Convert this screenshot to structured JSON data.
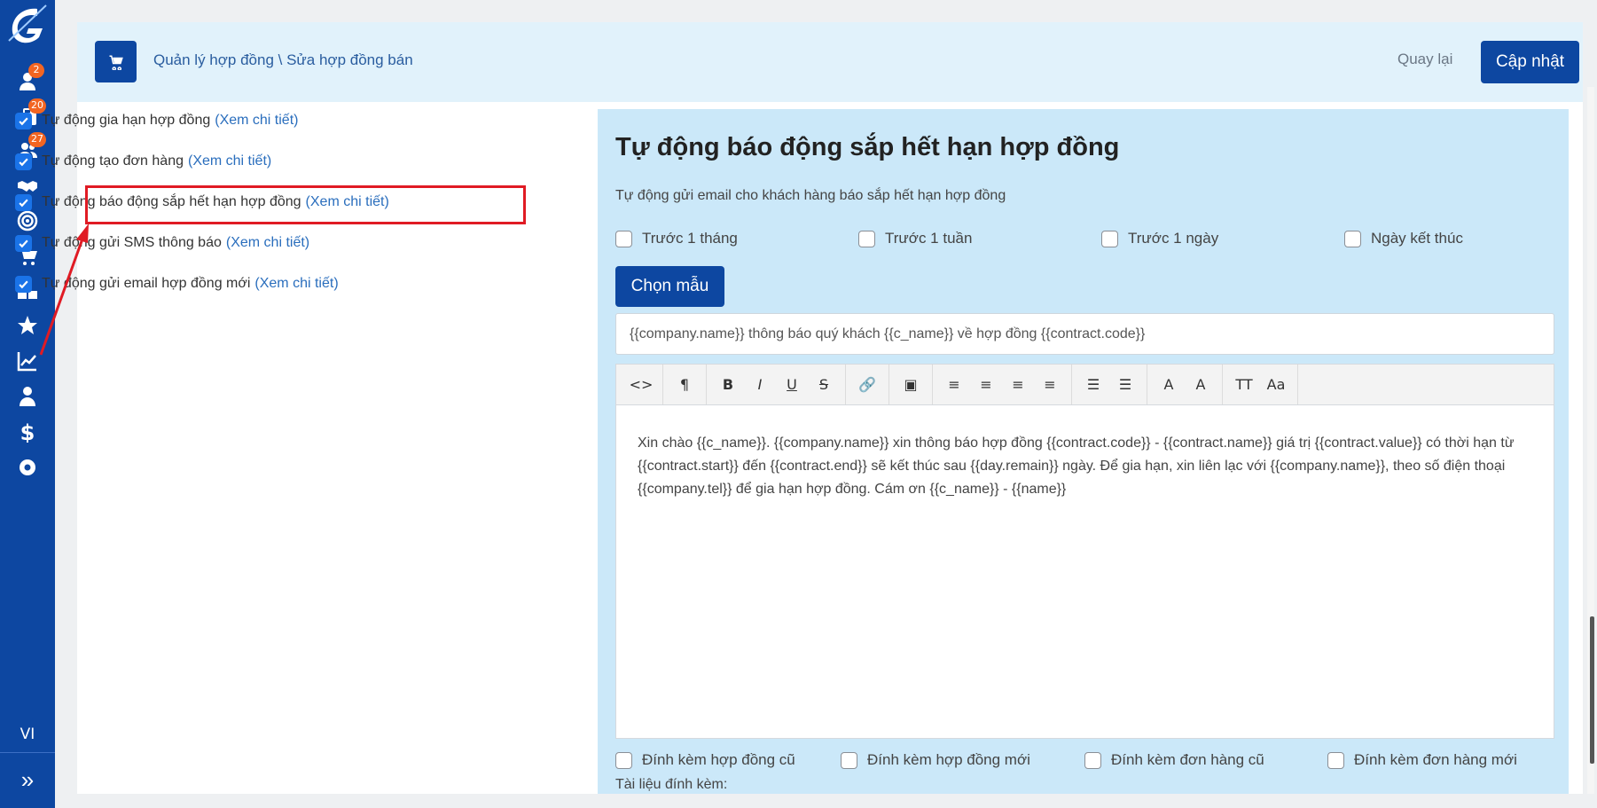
{
  "sidebar": {
    "items": [
      {
        "icon": "user-icon",
        "badge": "2"
      },
      {
        "icon": "briefcase-icon",
        "badge": "20"
      },
      {
        "icon": "users-icon",
        "badge": "27"
      },
      {
        "icon": "handshake-icon",
        "badge": ""
      },
      {
        "icon": "target-icon",
        "badge": ""
      },
      {
        "icon": "cart-icon",
        "badge": ""
      },
      {
        "icon": "cubes-icon",
        "badge": ""
      },
      {
        "icon": "star-icon",
        "badge": ""
      },
      {
        "icon": "chart-line-icon",
        "badge": ""
      },
      {
        "icon": "user-tie-icon",
        "badge": ""
      },
      {
        "icon": "dollar-icon",
        "badge": ""
      },
      {
        "icon": "gear-icon",
        "badge": ""
      }
    ],
    "language": "VI",
    "expand_icon": "double-chevron-right-icon",
    "accent_color": "#0d47a1",
    "badge_color": "#f26522"
  },
  "header": {
    "breadcrumb": "Quản lý hợp đồng \\ Sửa hợp đồng bán",
    "back_label": "Quay lại",
    "update_label": "Cập nhật"
  },
  "options": [
    {
      "label": "Tự động gia hạn hợp đồng",
      "link": "(Xem chi tiết)",
      "checked": true
    },
    {
      "label": "Tự động tạo đơn hàng",
      "link": "(Xem chi tiết)",
      "checked": true
    },
    {
      "label": "Tự động báo động sắp hết hạn hợp đồng",
      "link": "(Xem chi tiết)",
      "checked": true
    },
    {
      "label": "Tự động gửi SMS thông báo",
      "link": "(Xem chi tiết)",
      "checked": true
    },
    {
      "label": "Tự động gửi email hợp đồng mới",
      "link": "(Xem chi tiết)",
      "checked": true
    }
  ],
  "panel": {
    "title": "Tự động báo động sắp hết hạn hợp đồng",
    "subtitle": "Tự động gửi email cho khách hàng báo sắp hết hạn hợp đồng",
    "timing_options": [
      {
        "label": "Trước 1 tháng",
        "checked": false
      },
      {
        "label": "Trước 1 tuần",
        "checked": false
      },
      {
        "label": "Trước 1 ngày",
        "checked": false
      },
      {
        "label": "Ngày kết thúc",
        "checked": false
      }
    ],
    "template_button": "Chọn mẫu",
    "subject": "{{company.name}} thông báo quý khách {{c_name}} về hợp đồng {{contract.code}}",
    "body": "Xin chào {{c_name}}. {{company.name}} xin thông báo hợp đồng {{contract.code}} - {{contract.name}} giá trị {{contract.value}} có thời hạn từ {{contract.start}} đến {{contract.end}} sẽ kết thúc sau {{day.remain}} ngày. Để gia hạn, xin liên lạc với {{company.name}}, theo số điện thoại {{company.tel}} để gia hạn hợp đồng. Cám ơn {{c_name}} - {{name}}",
    "attach_options": [
      {
        "label": "Đính kèm hợp đồng cũ",
        "checked": false
      },
      {
        "label": "Đính kèm hợp đồng mới",
        "checked": false
      },
      {
        "label": "Đính kèm đơn hàng cũ",
        "checked": false
      },
      {
        "label": "Đính kèm đơn hàng mới",
        "checked": false
      }
    ],
    "attachments_label": "Tài liệu đính kèm:",
    "background_color": "#cbe8f9"
  },
  "toolbar": {
    "groups": [
      [
        {
          "icon": "code-view-icon",
          "glyph": "<>"
        }
      ],
      [
        {
          "icon": "paragraph-icon",
          "glyph": "¶"
        }
      ],
      [
        {
          "icon": "bold-icon",
          "glyph": "B"
        },
        {
          "icon": "italic-icon",
          "glyph": "I"
        },
        {
          "icon": "underline-icon",
          "glyph": "U"
        },
        {
          "icon": "strikethrough-icon",
          "glyph": "S"
        }
      ],
      [
        {
          "icon": "link-icon",
          "glyph": "🔗"
        }
      ],
      [
        {
          "icon": "image-icon",
          "glyph": "▣"
        }
      ],
      [
        {
          "icon": "align-left-icon",
          "glyph": "≡"
        },
        {
          "icon": "align-center-icon",
          "glyph": "≡"
        },
        {
          "icon": "align-right-icon",
          "glyph": "≡"
        },
        {
          "icon": "align-justify-icon",
          "glyph": "≡"
        }
      ],
      [
        {
          "icon": "unordered-list-icon",
          "glyph": "☰"
        },
        {
          "icon": "ordered-list-icon",
          "glyph": "☰"
        }
      ],
      [
        {
          "icon": "font-color-icon",
          "glyph": "A"
        },
        {
          "icon": "highlight-color-icon",
          "glyph": "A"
        }
      ],
      [
        {
          "icon": "font-size-icon",
          "glyph": "TT"
        },
        {
          "icon": "font-family-icon",
          "glyph": "Aa"
        }
      ]
    ]
  },
  "annotation": {
    "color": "#e01b24"
  }
}
